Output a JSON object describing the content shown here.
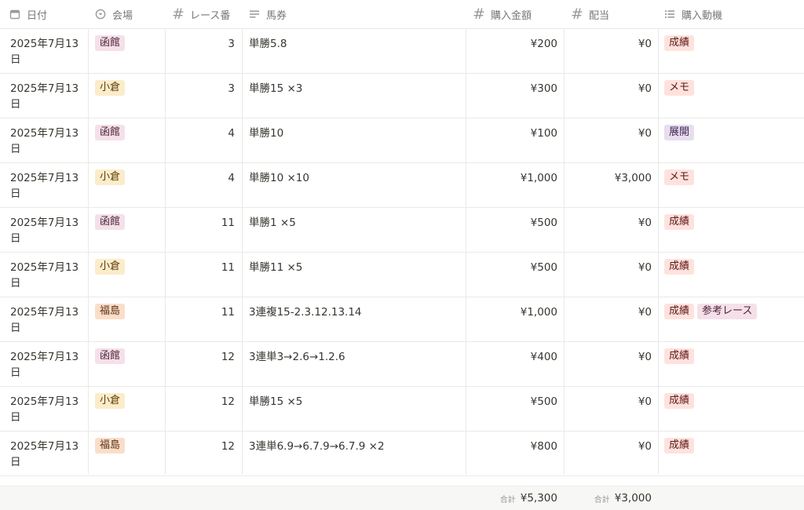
{
  "columns": [
    {
      "key": "date",
      "label": "日付",
      "icon": "calendar-icon"
    },
    {
      "key": "venue",
      "label": "会場",
      "icon": "select-icon"
    },
    {
      "key": "race",
      "label": "レース番",
      "icon": "number-icon"
    },
    {
      "key": "ticket",
      "label": "馬券",
      "icon": "text-icon"
    },
    {
      "key": "amount",
      "label": "購入金額",
      "icon": "number-icon"
    },
    {
      "key": "payout",
      "label": "配当",
      "icon": "number-icon"
    },
    {
      "key": "motive",
      "label": "購入動機",
      "icon": "multi-select-icon"
    }
  ],
  "rows": [
    {
      "date": "2025年7月13日",
      "venue": "函館",
      "race": "3",
      "ticket": "単勝5.8",
      "amount": "¥200",
      "payout": "¥0",
      "motive": [
        "成績"
      ]
    },
    {
      "date": "2025年7月13日",
      "venue": "小倉",
      "race": "3",
      "ticket": "単勝15 ×3",
      "amount": "¥300",
      "payout": "¥0",
      "motive": [
        "メモ"
      ]
    },
    {
      "date": "2025年7月13日",
      "venue": "函館",
      "race": "4",
      "ticket": "単勝10",
      "amount": "¥100",
      "payout": "¥0",
      "motive": [
        "展開"
      ]
    },
    {
      "date": "2025年7月13日",
      "venue": "小倉",
      "race": "4",
      "ticket": "単勝10 ×10",
      "amount": "¥1,000",
      "payout": "¥3,000",
      "motive": [
        "メモ"
      ]
    },
    {
      "date": "2025年7月13日",
      "venue": "函館",
      "race": "11",
      "ticket": "単勝1 ×5",
      "amount": "¥500",
      "payout": "¥0",
      "motive": [
        "成績"
      ]
    },
    {
      "date": "2025年7月13日",
      "venue": "小倉",
      "race": "11",
      "ticket": "単勝11 ×5",
      "amount": "¥500",
      "payout": "¥0",
      "motive": [
        "成績"
      ]
    },
    {
      "date": "2025年7月13日",
      "venue": "福島",
      "race": "11",
      "ticket": "3連複15-2.3.12.13.14",
      "amount": "¥1,000",
      "payout": "¥0",
      "motive": [
        "成績",
        "参考レース"
      ]
    },
    {
      "date": "2025年7月13日",
      "venue": "函館",
      "race": "12",
      "ticket": "3連単3→2.6→1.2.6",
      "amount": "¥400",
      "payout": "¥0",
      "motive": [
        "成績"
      ]
    },
    {
      "date": "2025年7月13日",
      "venue": "小倉",
      "race": "12",
      "ticket": "単勝15 ×5",
      "amount": "¥500",
      "payout": "¥0",
      "motive": [
        "成績"
      ]
    },
    {
      "date": "2025年7月13日",
      "venue": "福島",
      "race": "12",
      "ticket": "3連単6.9→6.7.9→6.7.9 ×2",
      "amount": "¥800",
      "payout": "¥0",
      "motive": [
        "成績"
      ]
    }
  ],
  "footer": {
    "amount_label": "合計",
    "amount_value": "¥5,300",
    "payout_label": "合計",
    "payout_value": "¥3,000"
  },
  "tag_colors": {
    "函館": {
      "bg": "#f5e0e9",
      "fg": "#4c2337"
    },
    "小倉": {
      "bg": "#fbecca",
      "fg": "#5a3e0a"
    },
    "福島": {
      "bg": "#fadec9",
      "fg": "#5c3116"
    },
    "成績": {
      "bg": "#ffe2dd",
      "fg": "#5d1715"
    },
    "メモ": {
      "bg": "#ffe2dd",
      "fg": "#5d1715"
    },
    "展開": {
      "bg": "#e8deee",
      "fg": "#412454"
    },
    "参考レース": {
      "bg": "#f5e0e9",
      "fg": "#4c2337"
    }
  }
}
